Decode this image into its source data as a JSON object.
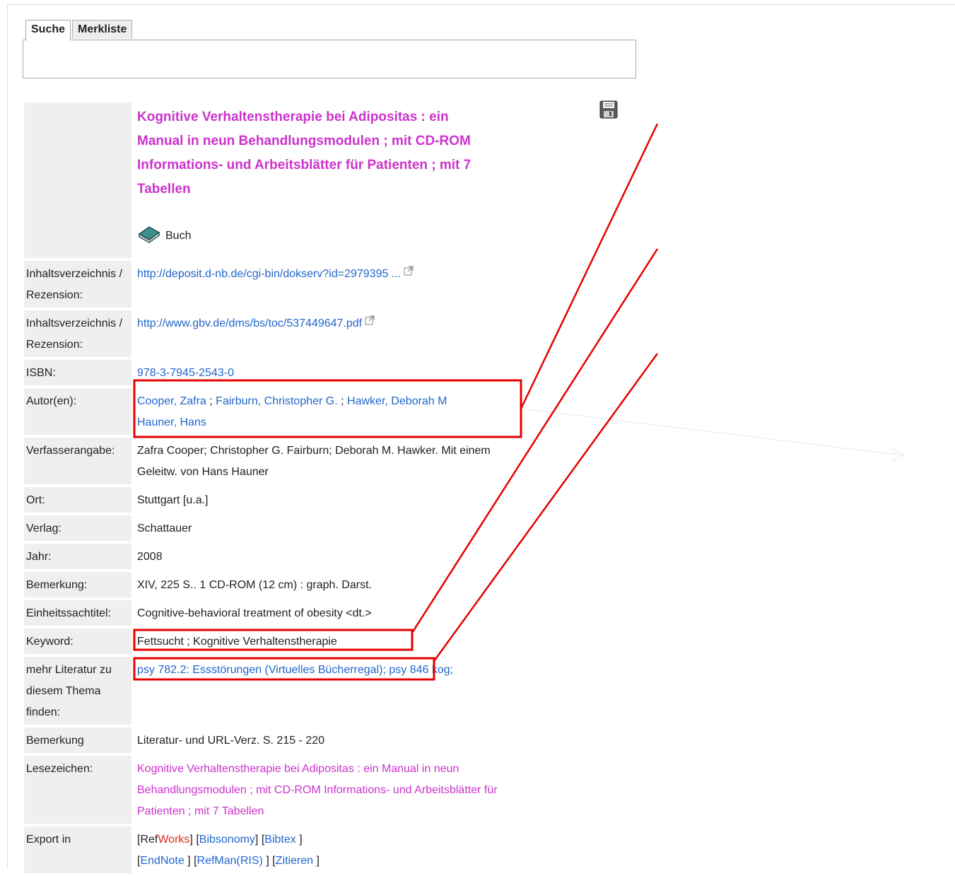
{
  "tabs": {
    "search": "Suche",
    "watchlist": "Merkliste"
  },
  "record": {
    "title": "Kognitive Verhaltenstherapie bei Adipositas : ein Manual in neun Behandlungsmodulen ; mit CD-ROM Informations- und Arbeitsblätter für Patienten ; mit 7 Tabellen",
    "media_type": "Buch"
  },
  "fields": {
    "toc1_label": "Inhaltsverzeichnis / Rezension:",
    "toc1_value": "http://deposit.d-nb.de/cgi-bin/dokserv?id=2979395 ...",
    "toc2_label": "Inhaltsverzeichnis / Rezension:",
    "toc2_value": "http://www.gbv.de/dms/bs/toc/537449647.pdf",
    "isbn_label": "ISBN:",
    "isbn_value": "978-3-7945-2543-0",
    "authors_label": "Autor(en):",
    "authors": [
      "Cooper, Zafra",
      "Fairburn, Christopher G.",
      "Hawker, Deborah M",
      "Hauner, Hans"
    ],
    "statement_label": "Verfasserangabe:",
    "statement_value": "Zafra Cooper; Christopher G. Fairburn; Deborah M. Hawker. Mit einem Geleitw. von Hans Hauner",
    "place_label": "Ort:",
    "place_value": "Stuttgart [u.a.]",
    "publisher_label": "Verlag:",
    "publisher_value": "Schattauer",
    "year_label": "Jahr:",
    "year_value": "2008",
    "note_label": "Bemerkung:",
    "note_value": "XIV, 225 S.. 1 CD-ROM (12 cm) : graph. Darst.",
    "uniform_title_label": "Einheitssachtitel:",
    "uniform_title_value": "Cognitive-behavioral treatment of obesity <dt.>",
    "keyword_label": "Keyword:",
    "keywords": [
      "Fettsucht",
      "Kognitive Verhaltenstherapie"
    ],
    "more_lit_label": "mehr Literatur zu diesem Thema finden:",
    "more_lit_1": "psy 782.2: Essstörungen (Virtuelles Bücherregal);",
    "more_lit_2": "psy 846 kog;",
    "remark_label": "Bemerkung",
    "remark_value": "Literatur- und URL-Verz. S. 215 - 220",
    "bookmark_label": "Lesezeichen:",
    "bookmark_value": "Kognitive Verhaltenstherapie bei Adipositas : ein Manual in neun Behandlungsmodulen ; mit CD-ROM Informations- und Arbeitsblätter für Patienten ; mit 7 Tabellen",
    "export_label": "Export in",
    "export": {
      "refworks_a": "Ref",
      "refworks_b": "Works",
      "bibsonomy": "Bibsonomy",
      "bibtex": "Bibtex",
      "endnote": "EndNote",
      "refman": "RefMan(RIS)",
      "cite": "Zitieren"
    }
  },
  "colors": {
    "title": "#cc33cc",
    "link": "#2266cc",
    "highlight": "#e60000",
    "label_bg": "#efefef"
  },
  "icons": {
    "save": "floppy-disk-icon",
    "book": "book-icon",
    "external": "external-link-icon"
  }
}
